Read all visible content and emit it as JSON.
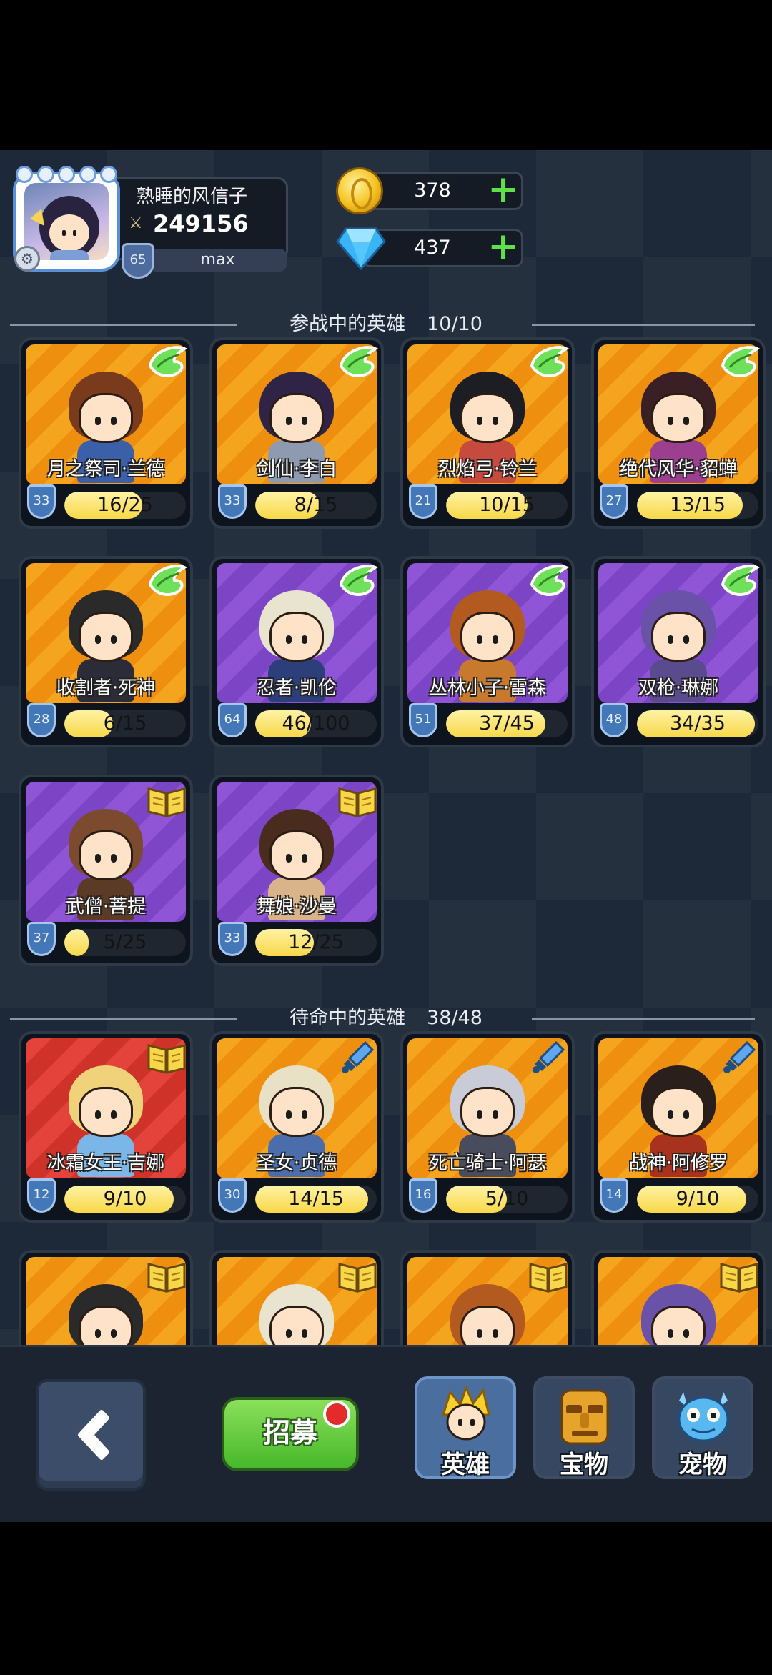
{
  "player": {
    "name": "熟睡的风信子",
    "power": "249156",
    "level": "65",
    "exp_text": "max"
  },
  "currency": {
    "gold": "378",
    "diamonds": "437"
  },
  "sections": {
    "active": {
      "title": "参战中的英雄",
      "count": "10/10"
    },
    "standby": {
      "title": "待命中的英雄",
      "count": "38/48"
    }
  },
  "active_heroes": [
    {
      "name": "月之祭司·兰德",
      "level": "33",
      "fragments": "16/25",
      "progress": 0.64,
      "bg": "orange",
      "badge": "wing-icon"
    },
    {
      "name": "剑仙·李白",
      "level": "33",
      "fragments": "8/15",
      "progress": 0.53,
      "bg": "orange",
      "badge": "wing-icon"
    },
    {
      "name": "烈焰弓·铃兰",
      "level": "21",
      "fragments": "10/15",
      "progress": 0.67,
      "bg": "orange",
      "badge": "wing-icon"
    },
    {
      "name": "绝代风华·貂蝉",
      "level": "27",
      "fragments": "13/15",
      "progress": 0.87,
      "bg": "orange",
      "badge": "wing-icon"
    },
    {
      "name": "收割者·死神",
      "level": "28",
      "fragments": "6/15",
      "progress": 0.4,
      "bg": "orange",
      "badge": "wing-icon"
    },
    {
      "name": "忍者·凯伦",
      "level": "64",
      "fragments": "46/100",
      "progress": 0.46,
      "bg": "purple",
      "badge": "wing-icon"
    },
    {
      "name": "丛林小子·雷森",
      "level": "51",
      "fragments": "37/45",
      "progress": 0.82,
      "bg": "purple",
      "badge": "wing-icon"
    },
    {
      "name": "双枪·琳娜",
      "level": "48",
      "fragments": "34/35",
      "progress": 0.97,
      "bg": "purple",
      "badge": "wing-icon"
    },
    {
      "name": "武僧·菩提",
      "level": "37",
      "fragments": "5/25",
      "progress": 0.2,
      "bg": "purple",
      "badge": "book-icon"
    },
    {
      "name": "舞娘·沙曼",
      "level": "33",
      "fragments": "12/25",
      "progress": 0.48,
      "bg": "purple",
      "badge": "book-icon"
    }
  ],
  "standby_heroes": [
    {
      "name": "冰霜女王·吉娜",
      "level": "12",
      "fragments": "9/10",
      "progress": 0.9,
      "bg": "red",
      "badge": "book-icon"
    },
    {
      "name": "圣女·贞德",
      "level": "30",
      "fragments": "14/15",
      "progress": 0.93,
      "bg": "orange",
      "badge": "sword-icon"
    },
    {
      "name": "死亡骑士·阿瑟",
      "level": "16",
      "fragments": "5/10",
      "progress": 0.5,
      "bg": "orange",
      "badge": "sword-icon"
    },
    {
      "name": "战神·阿修罗",
      "level": "14",
      "fragments": "9/10",
      "progress": 0.9,
      "bg": "orange",
      "badge": "sword-icon"
    }
  ],
  "partial_heroes": [
    {
      "bg": "orange",
      "badge": "book-icon"
    },
    {
      "bg": "orange",
      "badge": "book-icon"
    },
    {
      "bg": "orange",
      "badge": "book-icon"
    },
    {
      "bg": "orange",
      "badge": "book-icon"
    }
  ],
  "nav": {
    "recruit_label": "招募",
    "tabs": [
      {
        "label": "英雄",
        "icon": "hero-icon",
        "active": true
      },
      {
        "label": "宝物",
        "icon": "treasure-icon",
        "active": false
      },
      {
        "label": "宠物",
        "icon": "pet-icon",
        "active": false
      }
    ]
  },
  "colors": {
    "accent_green": "#5fe04a",
    "fragment_fill": "#f8d848",
    "background": "#1d2838"
  }
}
